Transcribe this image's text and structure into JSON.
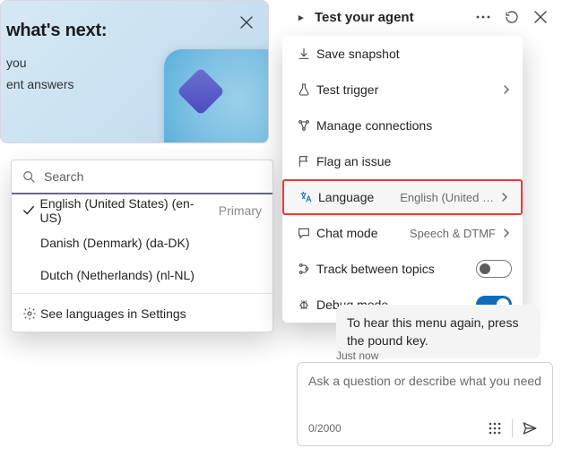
{
  "card": {
    "title": "what's next:",
    "line1": "you",
    "line2": "ent answers"
  },
  "language_popup": {
    "search_placeholder": "Search",
    "items": [
      {
        "label": "English (United States) (en-US)",
        "selected": true,
        "primary": "Primary"
      },
      {
        "label": "Danish (Denmark) (da-DK)",
        "selected": false
      },
      {
        "label": "Dutch (Netherlands) (nl-NL)",
        "selected": false
      }
    ],
    "settings_label": "See languages in Settings"
  },
  "panel": {
    "title": "Test your agent"
  },
  "menu": {
    "save_snapshot": "Save snapshot",
    "test_trigger": "Test trigger",
    "manage_connections": "Manage connections",
    "flag_issue": "Flag an issue",
    "language_label": "Language",
    "language_value": "English (United …",
    "chat_mode_label": "Chat mode",
    "chat_mode_value": "Speech & DTMF",
    "track_label": "Track between topics",
    "track_on": false,
    "debug_label": "Debug mode",
    "debug_on": true
  },
  "chat": {
    "bubble": "To hear this menu again, press the pound key.",
    "timestamp": "Just now",
    "placeholder": "Ask a question or describe what you need",
    "counter": "0/2000"
  }
}
